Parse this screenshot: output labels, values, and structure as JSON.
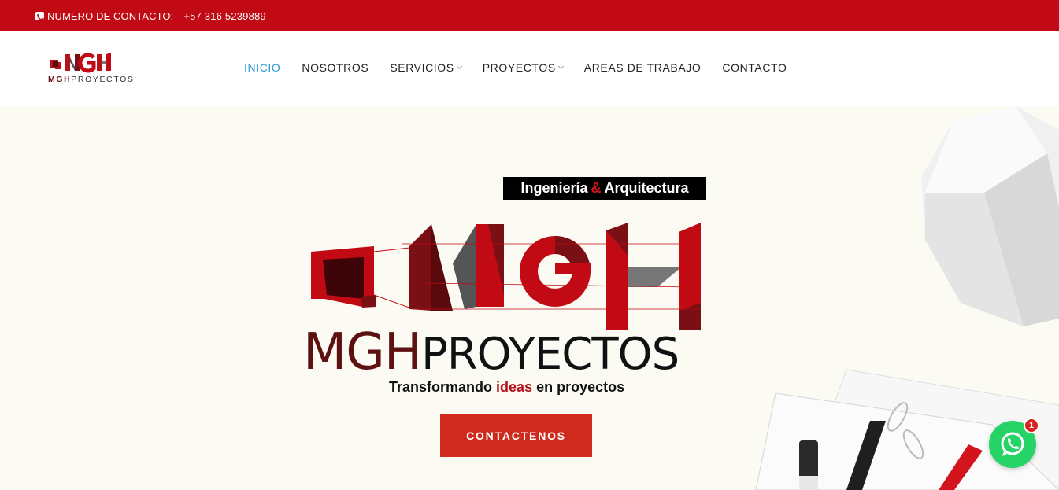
{
  "topbar": {
    "contact_label": "NUMERO DE CONTACTO:",
    "contact_number": "+57 316 5239889",
    "icon": "phone-icon"
  },
  "header": {
    "logo_text": "MGH",
    "logo_subtext": "MGH PROYECTOS",
    "nav": [
      {
        "label": "INICIO",
        "active": true,
        "dropdown": false
      },
      {
        "label": "NOSOTROS",
        "active": false,
        "dropdown": false
      },
      {
        "label": "SERVICIOS",
        "active": false,
        "dropdown": true
      },
      {
        "label": "PROYECTOS",
        "active": false,
        "dropdown": true
      },
      {
        "label": "AREAS DE TRABAJO",
        "active": false,
        "dropdown": false
      },
      {
        "label": "CONTACTO",
        "active": false,
        "dropdown": false
      }
    ]
  },
  "hero": {
    "tagline_part1": "Ingeniería",
    "tagline_amp": "&",
    "tagline_part2": "Arquitectura",
    "brand_part1": "MGH",
    "brand_part2": "PROYECTOS",
    "slogan_part1": "Transformando",
    "slogan_highlight": "ideas",
    "slogan_part2": "en proyectos",
    "cta_label": "CONTACTENOS"
  },
  "whatsapp": {
    "icon": "whatsapp-icon",
    "badge_count": "1"
  },
  "colors": {
    "primary_red": "#c10a13",
    "nav_active": "#2c9ad6",
    "cta": "#cf2a1d",
    "whatsapp": "#25d366"
  }
}
